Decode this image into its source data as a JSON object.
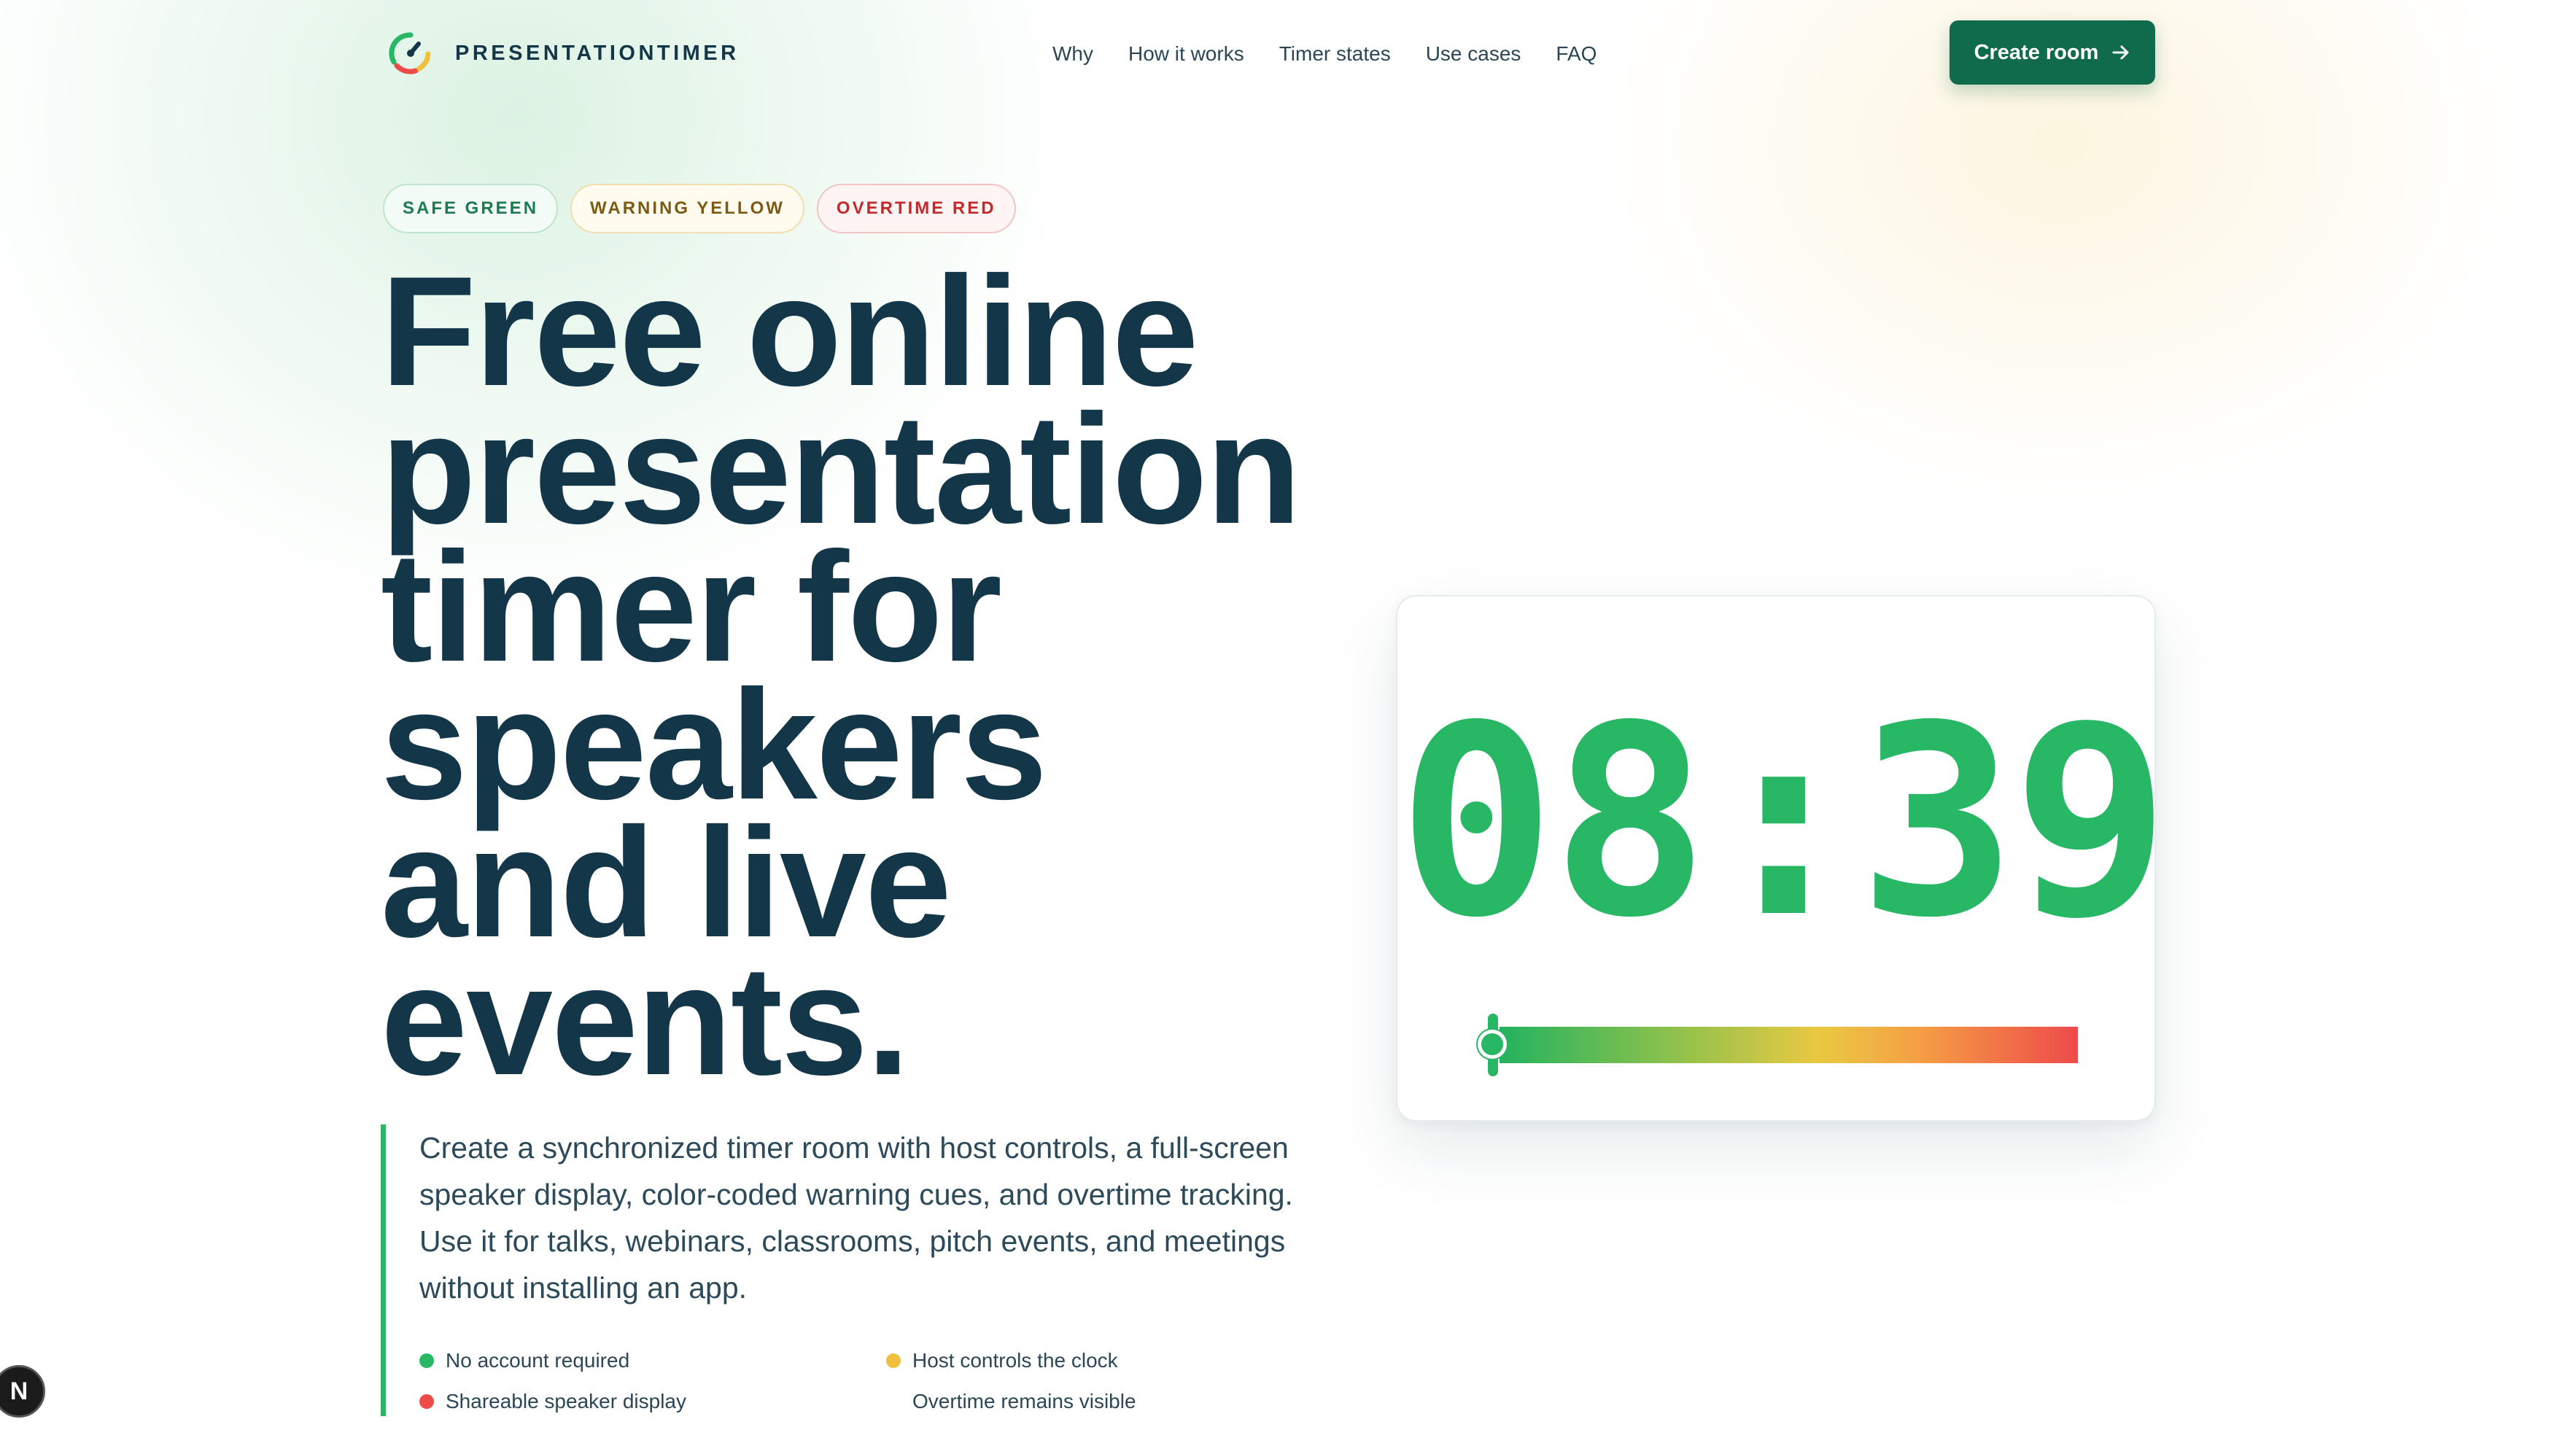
{
  "header": {
    "logo_text": "PRESENTATIONTIMER",
    "nav": [
      "Why",
      "How it works",
      "Timer states",
      "Use cases",
      "FAQ"
    ],
    "cta_label": "Create room"
  },
  "chips": {
    "safe": "SAFE GREEN",
    "warning": "WARNING YELLOW",
    "overtime": "OVERTIME RED"
  },
  "hero": {
    "headline_lines": [
      "Free online",
      "presentation",
      "timer for",
      "speakers",
      "and live",
      "events."
    ],
    "description": "Create a synchronized timer room with host controls, a full-screen speaker display, color-coded warning cues, and overtime tracking. Use it for talks, webinars, classrooms, pitch events, and meetings without installing an app.",
    "features": [
      {
        "label": "No account required",
        "dot": "#27b765"
      },
      {
        "label": "Host controls the clock",
        "dot": "#f0c03c"
      },
      {
        "label": "Shareable speaker display",
        "dot": "#ee4a4a"
      },
      {
        "label": "Overtime remains visible",
        "dot": ""
      }
    ]
  },
  "timer": {
    "time": "08:39",
    "color": "#27b765"
  },
  "badge": {
    "letter": "N"
  },
  "colors": {
    "brand_dark": "#143649",
    "cta": "#0f6b4c",
    "green": "#27b765",
    "yellow": "#f0c03c",
    "red": "#ee4a4a"
  }
}
